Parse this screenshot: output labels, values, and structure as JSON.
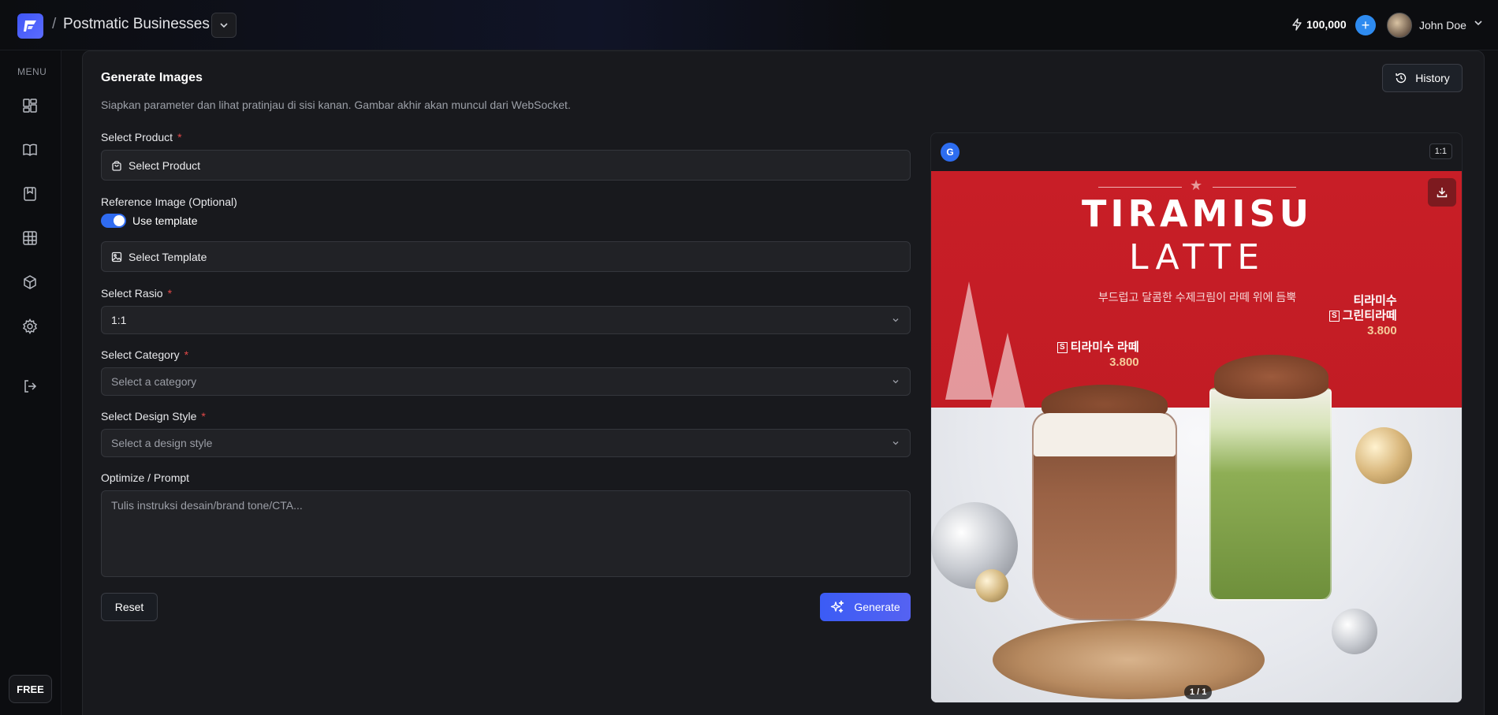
{
  "header": {
    "separator": "/",
    "workspace_name": "Postmatic Businesses",
    "credits": "100,000",
    "add_credits_label": "+",
    "username": "John Doe"
  },
  "sidebar": {
    "menu_label": "MENU",
    "items": [
      {
        "icon": "dashboard-icon"
      },
      {
        "icon": "book-icon"
      },
      {
        "icon": "bookmark-icon"
      },
      {
        "icon": "grid-icon"
      },
      {
        "icon": "box-icon"
      },
      {
        "icon": "gear-icon"
      },
      {
        "icon": "logout-icon"
      }
    ],
    "plan_badge": "FREE"
  },
  "main": {
    "title": "Generate Images",
    "subtitle": "Siapkan parameter dan lihat pratinjau di sisi kanan. Gambar akhir akan muncul dari WebSocket.",
    "history_label": "History",
    "fields": {
      "product": {
        "label": "Select Product",
        "required": "*",
        "value": "Select Product"
      },
      "reference": {
        "label": "Reference Image (Optional)",
        "toggle_label": "Use template",
        "toggle_on": true,
        "value": "Select Template"
      },
      "ratio": {
        "label": "Select Rasio",
        "required": "*",
        "value": "1:1"
      },
      "category": {
        "label": "Select Category",
        "required": "*",
        "placeholder": "Select a category"
      },
      "design_style": {
        "label": "Select Design Style",
        "required": "*",
        "placeholder": "Select a design style"
      },
      "prompt": {
        "label": "Optimize / Prompt",
        "placeholder": "Tulis instruksi desain/brand tone/CTA..."
      }
    },
    "reset_label": "Reset",
    "generate_label": "Generate"
  },
  "preview": {
    "model_badge": "G",
    "ratio_badge": "1:1",
    "page_indicator": "1 / 1",
    "poster": {
      "title_line1": "TIRAMISU",
      "title_line2": "LATTE",
      "subtitle": "부드럽고 달콤한 수제크림이 라떼 위에 듬뿍",
      "item_left_mark": "S",
      "item_left_name": "티라미수 라떼",
      "item_left_price": "3.800",
      "item_right_name_1": "티라미수",
      "item_right_mark": "S",
      "item_right_name_2": "그린티라떼",
      "item_right_price": "3.800"
    }
  },
  "colors": {
    "accent": "#3b5cf5",
    "credits_button": "#2e8bf0",
    "required": "#e24848",
    "poster_red": "#c81e27"
  }
}
